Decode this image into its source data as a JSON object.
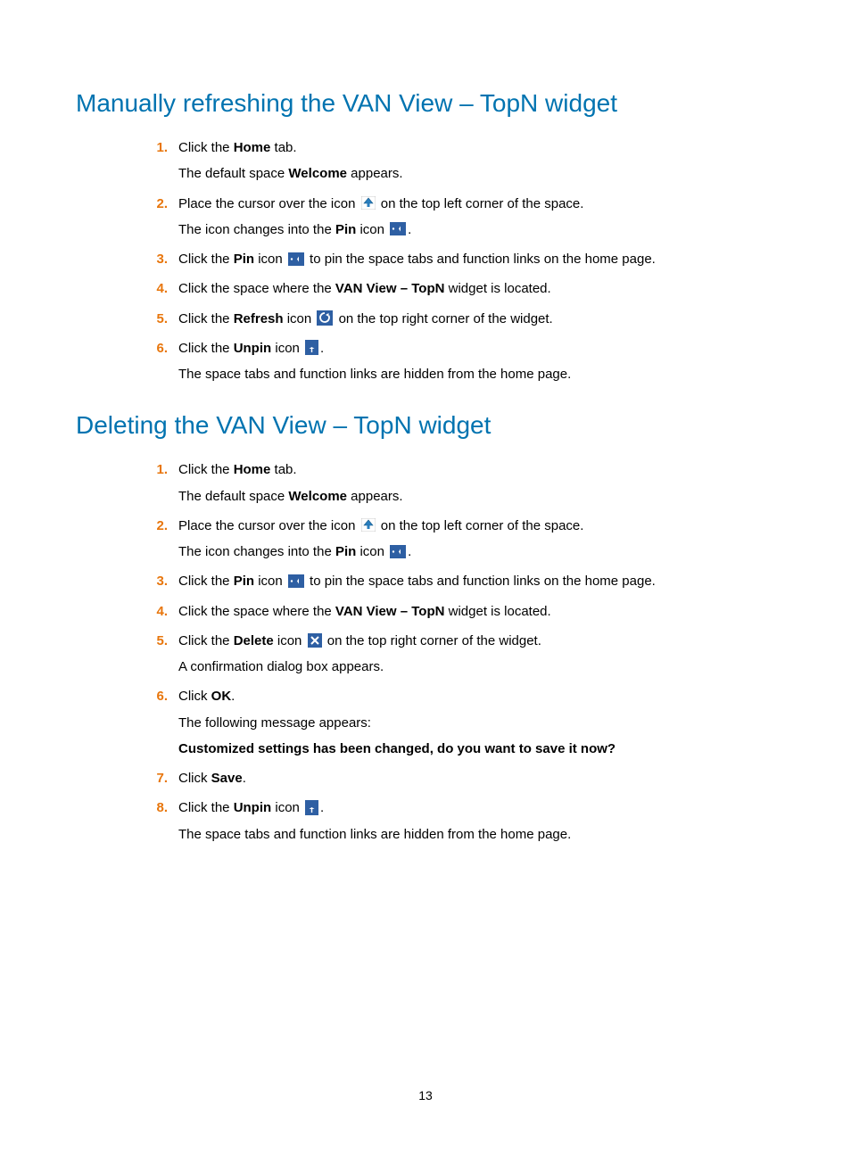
{
  "page_number": "13",
  "sections": [
    {
      "title": "Manually refreshing the VAN View – TopN widget",
      "steps": [
        {
          "num": "1.",
          "parts": [
            {
              "t": "text",
              "v": "Click the "
            },
            {
              "t": "bold",
              "v": "Home"
            },
            {
              "t": "text",
              "v": " tab."
            }
          ],
          "subs": [
            [
              {
                "t": "text",
                "v": "The default space "
              },
              {
                "t": "bold",
                "v": "Welcome"
              },
              {
                "t": "text",
                "v": " appears."
              }
            ]
          ]
        },
        {
          "num": "2.",
          "parts": [
            {
              "t": "text",
              "v": "Place the cursor over the icon "
            },
            {
              "t": "icon",
              "v": "cursor-up-icon"
            },
            {
              "t": "text",
              "v": " on the top left corner of the space."
            }
          ],
          "subs": [
            [
              {
                "t": "text",
                "v": "The icon changes into the "
              },
              {
                "t": "bold",
                "v": "Pin"
              },
              {
                "t": "text",
                "v": " icon "
              },
              {
                "t": "icon",
                "v": "pin-icon"
              },
              {
                "t": "text",
                "v": "."
              }
            ]
          ]
        },
        {
          "num": "3.",
          "parts": [
            {
              "t": "text",
              "v": "Click the "
            },
            {
              "t": "bold",
              "v": "Pin"
            },
            {
              "t": "text",
              "v": " icon "
            },
            {
              "t": "icon",
              "v": "pin-icon"
            },
            {
              "t": "text",
              "v": " to pin the space tabs and function links on the home page."
            }
          ],
          "subs": []
        },
        {
          "num": "4.",
          "parts": [
            {
              "t": "text",
              "v": "Click the space where the "
            },
            {
              "t": "bold",
              "v": "VAN View – TopN"
            },
            {
              "t": "text",
              "v": " widget is located."
            }
          ],
          "subs": []
        },
        {
          "num": "5.",
          "parts": [
            {
              "t": "text",
              "v": "Click the "
            },
            {
              "t": "bold",
              "v": "Refresh"
            },
            {
              "t": "text",
              "v": " icon "
            },
            {
              "t": "icon",
              "v": "refresh-icon"
            },
            {
              "t": "text",
              "v": " on the top right corner of the widget."
            }
          ],
          "subs": []
        },
        {
          "num": "6.",
          "parts": [
            {
              "t": "text",
              "v": "Click the "
            },
            {
              "t": "bold",
              "v": "Unpin"
            },
            {
              "t": "text",
              "v": " icon "
            },
            {
              "t": "icon",
              "v": "unpin-icon"
            },
            {
              "t": "text",
              "v": "."
            }
          ],
          "subs": [
            [
              {
                "t": "text",
                "v": "The space tabs and function links are hidden from the home page."
              }
            ]
          ]
        }
      ]
    },
    {
      "title": "Deleting the VAN View – TopN widget",
      "steps": [
        {
          "num": "1.",
          "parts": [
            {
              "t": "text",
              "v": "Click the "
            },
            {
              "t": "bold",
              "v": "Home"
            },
            {
              "t": "text",
              "v": " tab."
            }
          ],
          "subs": [
            [
              {
                "t": "text",
                "v": "The default space "
              },
              {
                "t": "bold",
                "v": "Welcome"
              },
              {
                "t": "text",
                "v": " appears."
              }
            ]
          ]
        },
        {
          "num": "2.",
          "parts": [
            {
              "t": "text",
              "v": "Place the cursor over the icon "
            },
            {
              "t": "icon",
              "v": "cursor-up-icon"
            },
            {
              "t": "text",
              "v": " on the top left corner of the space."
            }
          ],
          "subs": [
            [
              {
                "t": "text",
                "v": "The icon changes into the "
              },
              {
                "t": "bold",
                "v": "Pin"
              },
              {
                "t": "text",
                "v": " icon "
              },
              {
                "t": "icon",
                "v": "pin-icon"
              },
              {
                "t": "text",
                "v": "."
              }
            ]
          ]
        },
        {
          "num": "3.",
          "parts": [
            {
              "t": "text",
              "v": "Click the "
            },
            {
              "t": "bold",
              "v": "Pin"
            },
            {
              "t": "text",
              "v": " icon "
            },
            {
              "t": "icon",
              "v": "pin-icon"
            },
            {
              "t": "text",
              "v": " to pin the space tabs and function links on the home page."
            }
          ],
          "subs": []
        },
        {
          "num": "4.",
          "parts": [
            {
              "t": "text",
              "v": "Click the space where the "
            },
            {
              "t": "bold",
              "v": "VAN View – TopN"
            },
            {
              "t": "text",
              "v": " widget is located."
            }
          ],
          "subs": []
        },
        {
          "num": "5.",
          "parts": [
            {
              "t": "text",
              "v": "Click the "
            },
            {
              "t": "bold",
              "v": "Delete"
            },
            {
              "t": "text",
              "v": " icon "
            },
            {
              "t": "icon",
              "v": "delete-icon"
            },
            {
              "t": "text",
              "v": " on the top right corner of the widget."
            }
          ],
          "subs": [
            [
              {
                "t": "text",
                "v": "A confirmation dialog box appears."
              }
            ]
          ]
        },
        {
          "num": "6.",
          "parts": [
            {
              "t": "text",
              "v": "Click "
            },
            {
              "t": "bold",
              "v": "OK"
            },
            {
              "t": "text",
              "v": "."
            }
          ],
          "subs": [
            [
              {
                "t": "text",
                "v": "The following message appears:"
              }
            ],
            [
              {
                "t": "bold",
                "v": "Customized settings has been changed, do you want to save it now?"
              }
            ]
          ]
        },
        {
          "num": "7.",
          "parts": [
            {
              "t": "text",
              "v": "Click "
            },
            {
              "t": "bold",
              "v": "Save"
            },
            {
              "t": "text",
              "v": "."
            }
          ],
          "subs": []
        },
        {
          "num": "8.",
          "parts": [
            {
              "t": "text",
              "v": "Click the "
            },
            {
              "t": "bold",
              "v": "Unpin"
            },
            {
              "t": "text",
              "v": " icon "
            },
            {
              "t": "icon",
              "v": "unpin-icon"
            },
            {
              "t": "text",
              "v": "."
            }
          ],
          "subs": [
            [
              {
                "t": "text",
                "v": "The space tabs and function links are hidden from the home page."
              }
            ]
          ]
        }
      ]
    }
  ]
}
